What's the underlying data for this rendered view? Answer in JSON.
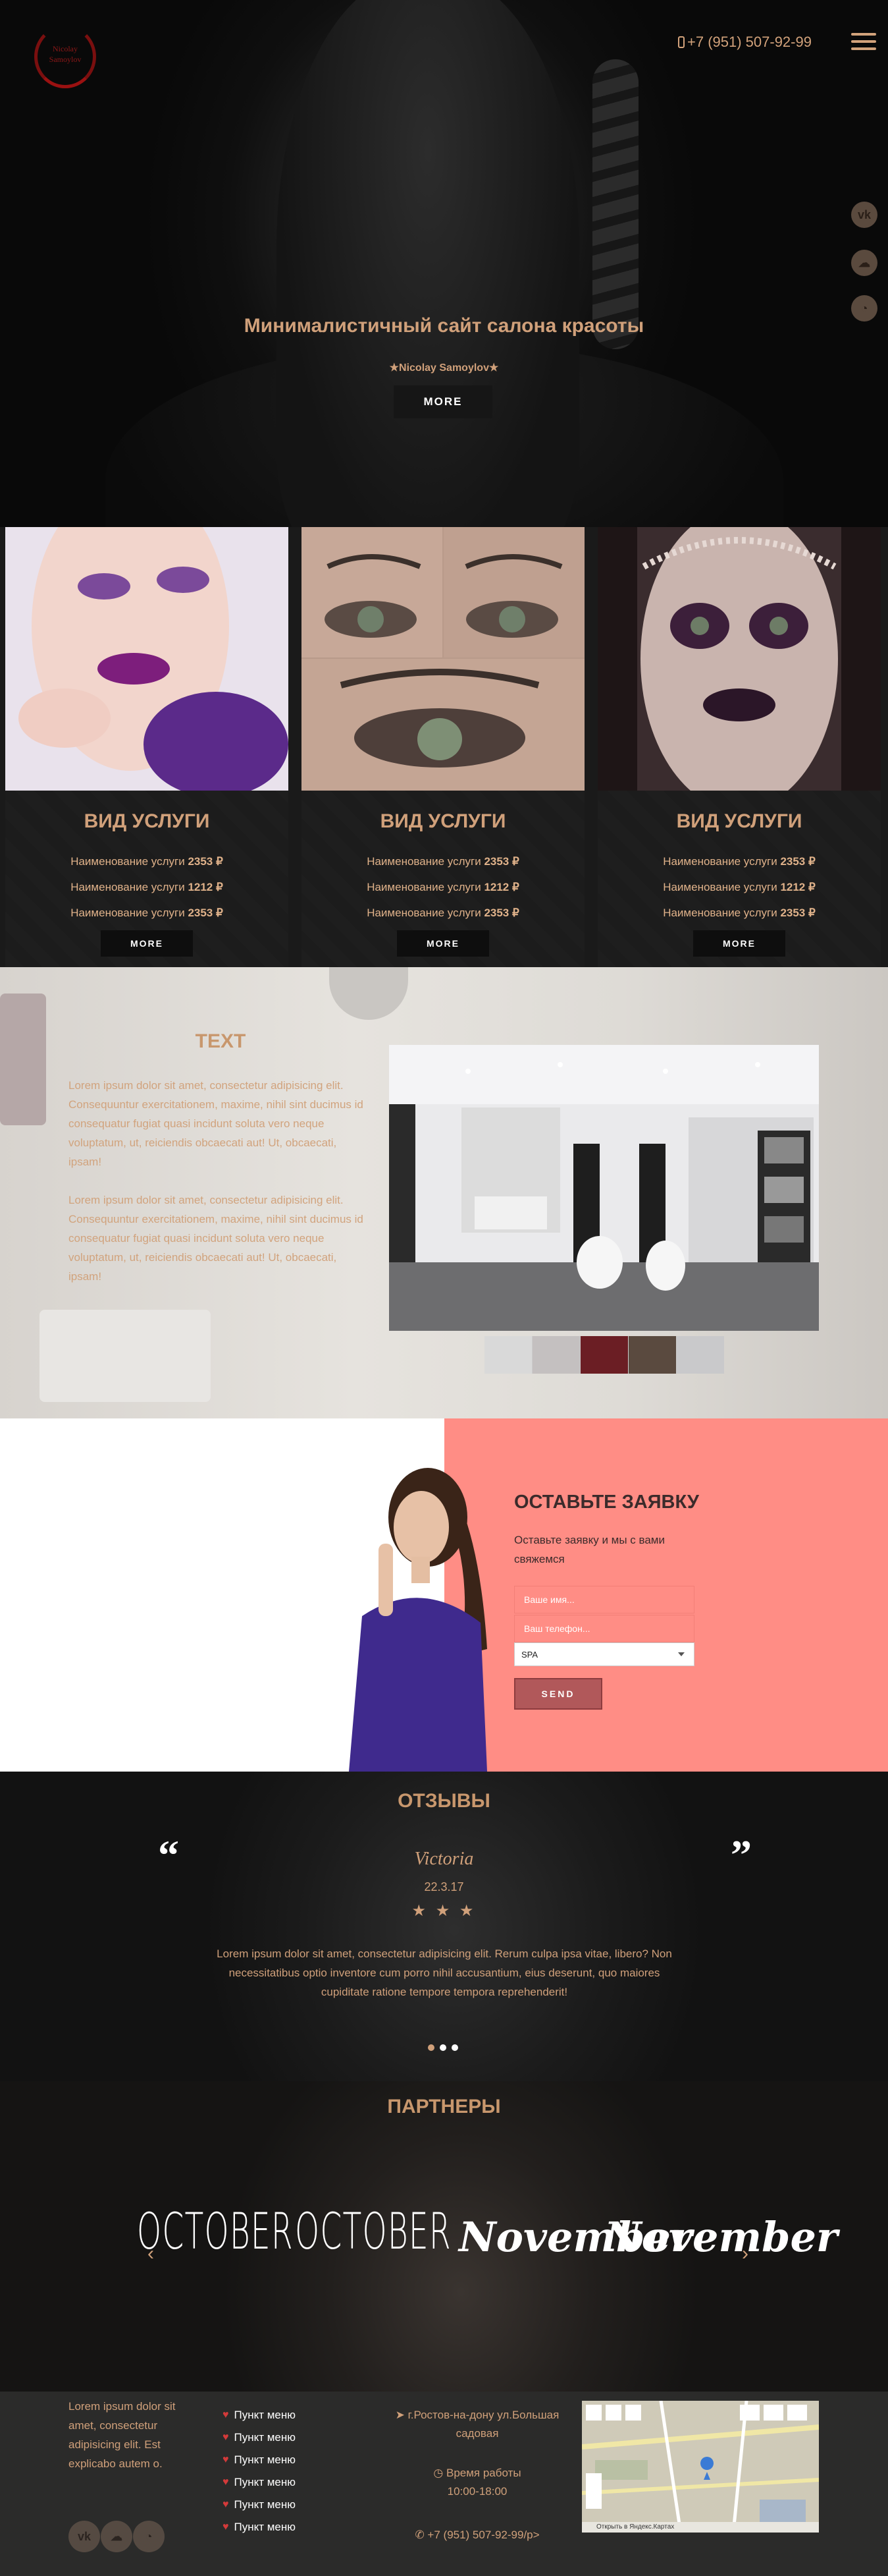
{
  "header": {
    "logo_line1": "Nicolay",
    "logo_line2": "Samoylov",
    "phone": "+7 (951) 507-92-99",
    "menu_icon": "hamburger-icon",
    "side_social": [
      "vk-icon",
      "soundcloud-icon",
      "github-icon"
    ]
  },
  "hero": {
    "title": "Минималистичный сайт салона красоты",
    "author": "★Nicolay Samoylov★",
    "button": "MORE"
  },
  "services": [
    {
      "title": "ВИД УСЛУГИ",
      "rows": [
        {
          "name": "Наименование услуги",
          "price": "2353 ₽"
        },
        {
          "name": "Наименование услуги",
          "price": "1212 ₽"
        },
        {
          "name": "Наименование услуги",
          "price": "2353 ₽"
        }
      ],
      "button": "MORE"
    },
    {
      "title": "ВИД УСЛУГИ",
      "rows": [
        {
          "name": "Наименование услуги",
          "price": "2353 ₽"
        },
        {
          "name": "Наименование услуги",
          "price": "1212 ₽"
        },
        {
          "name": "Наименование услуги",
          "price": "2353 ₽"
        }
      ],
      "button": "MORE"
    },
    {
      "title": "ВИД УСЛУГИ",
      "rows": [
        {
          "name": "Наименование услуги",
          "price": "2353 ₽"
        },
        {
          "name": "Наименование услуги",
          "price": "1212 ₽"
        },
        {
          "name": "Наименование услуги",
          "price": "2353 ₽"
        }
      ],
      "button": "MORE"
    }
  ],
  "about": {
    "title": "TEXT",
    "p1": "Lorem ipsum dolor sit amet, consectetur adipisicing elit. Consequuntur exercitationem, maxime, nihil sint ducimus id consequatur fugiat quasi incidunt soluta vero neque voluptatum, ut, reiciendis obcaecati aut! Ut, obcaecati, ipsam!",
    "p2": "Lorem ipsum dolor sit amet, consectetur adipisicing elit. Consequuntur exercitationem, maxime, nihil sint ducimus id consequatur fugiat quasi incidunt soluta vero neque voluptatum, ut, reiciendis obcaecati aut! Ut, obcaecati, ipsam!"
  },
  "form": {
    "title": "ОСТАВЬТЕ ЗАЯВКУ",
    "subtitle": "Оставьте заявку и мы с вами свяжемся",
    "name_placeholder": "Ваше имя...",
    "phone_placeholder": "Ваш телефон...",
    "select_value": "SPA",
    "send_button": "SEND"
  },
  "reviews": {
    "title": "ОТЗЫВЫ",
    "open_quote": "“",
    "close_quote": "”",
    "name": "Victoria",
    "date": "22.3.17",
    "stars": "★ ★ ★",
    "text": "Lorem ipsum dolor sit amet, consectetur adipisicing elit. Rerum culpa ipsa vitae, libero? Non necessitatibus optio inventore cum porro nihil accusantium, eius deserunt, quo maiores cupiditate ratione tempore tempora reprehenderit!"
  },
  "partners": {
    "title": "ПАРТНЕРЫ",
    "brands": [
      "OCTOBER",
      "OCTOBER",
      "November",
      "November"
    ],
    "prev": "‹",
    "next": "›"
  },
  "footer": {
    "text": "Lorem ipsum dolor sit amet, consectetur adipisicing elit. Est explicabo autem o.",
    "social": [
      "vk-icon",
      "soundcloud-icon",
      "github-icon"
    ],
    "menu": [
      "Пункт меню",
      "Пункт меню",
      "Пункт меню",
      "Пункт меню",
      "Пункт меню",
      "Пункт меню"
    ],
    "address": "г.Ростов-на-дону ул.Большая садовая",
    "hours_label": "Время работы",
    "hours": "10:00-18:00",
    "phone": "+7 (951) 507-92-99/p>",
    "map_label": "Открыть в Яндекс.Картах"
  },
  "colors": {
    "accent": "#d0a07a",
    "form_bg": "#ff8d85",
    "send_button": "#b1585a",
    "dark": "#161616"
  }
}
